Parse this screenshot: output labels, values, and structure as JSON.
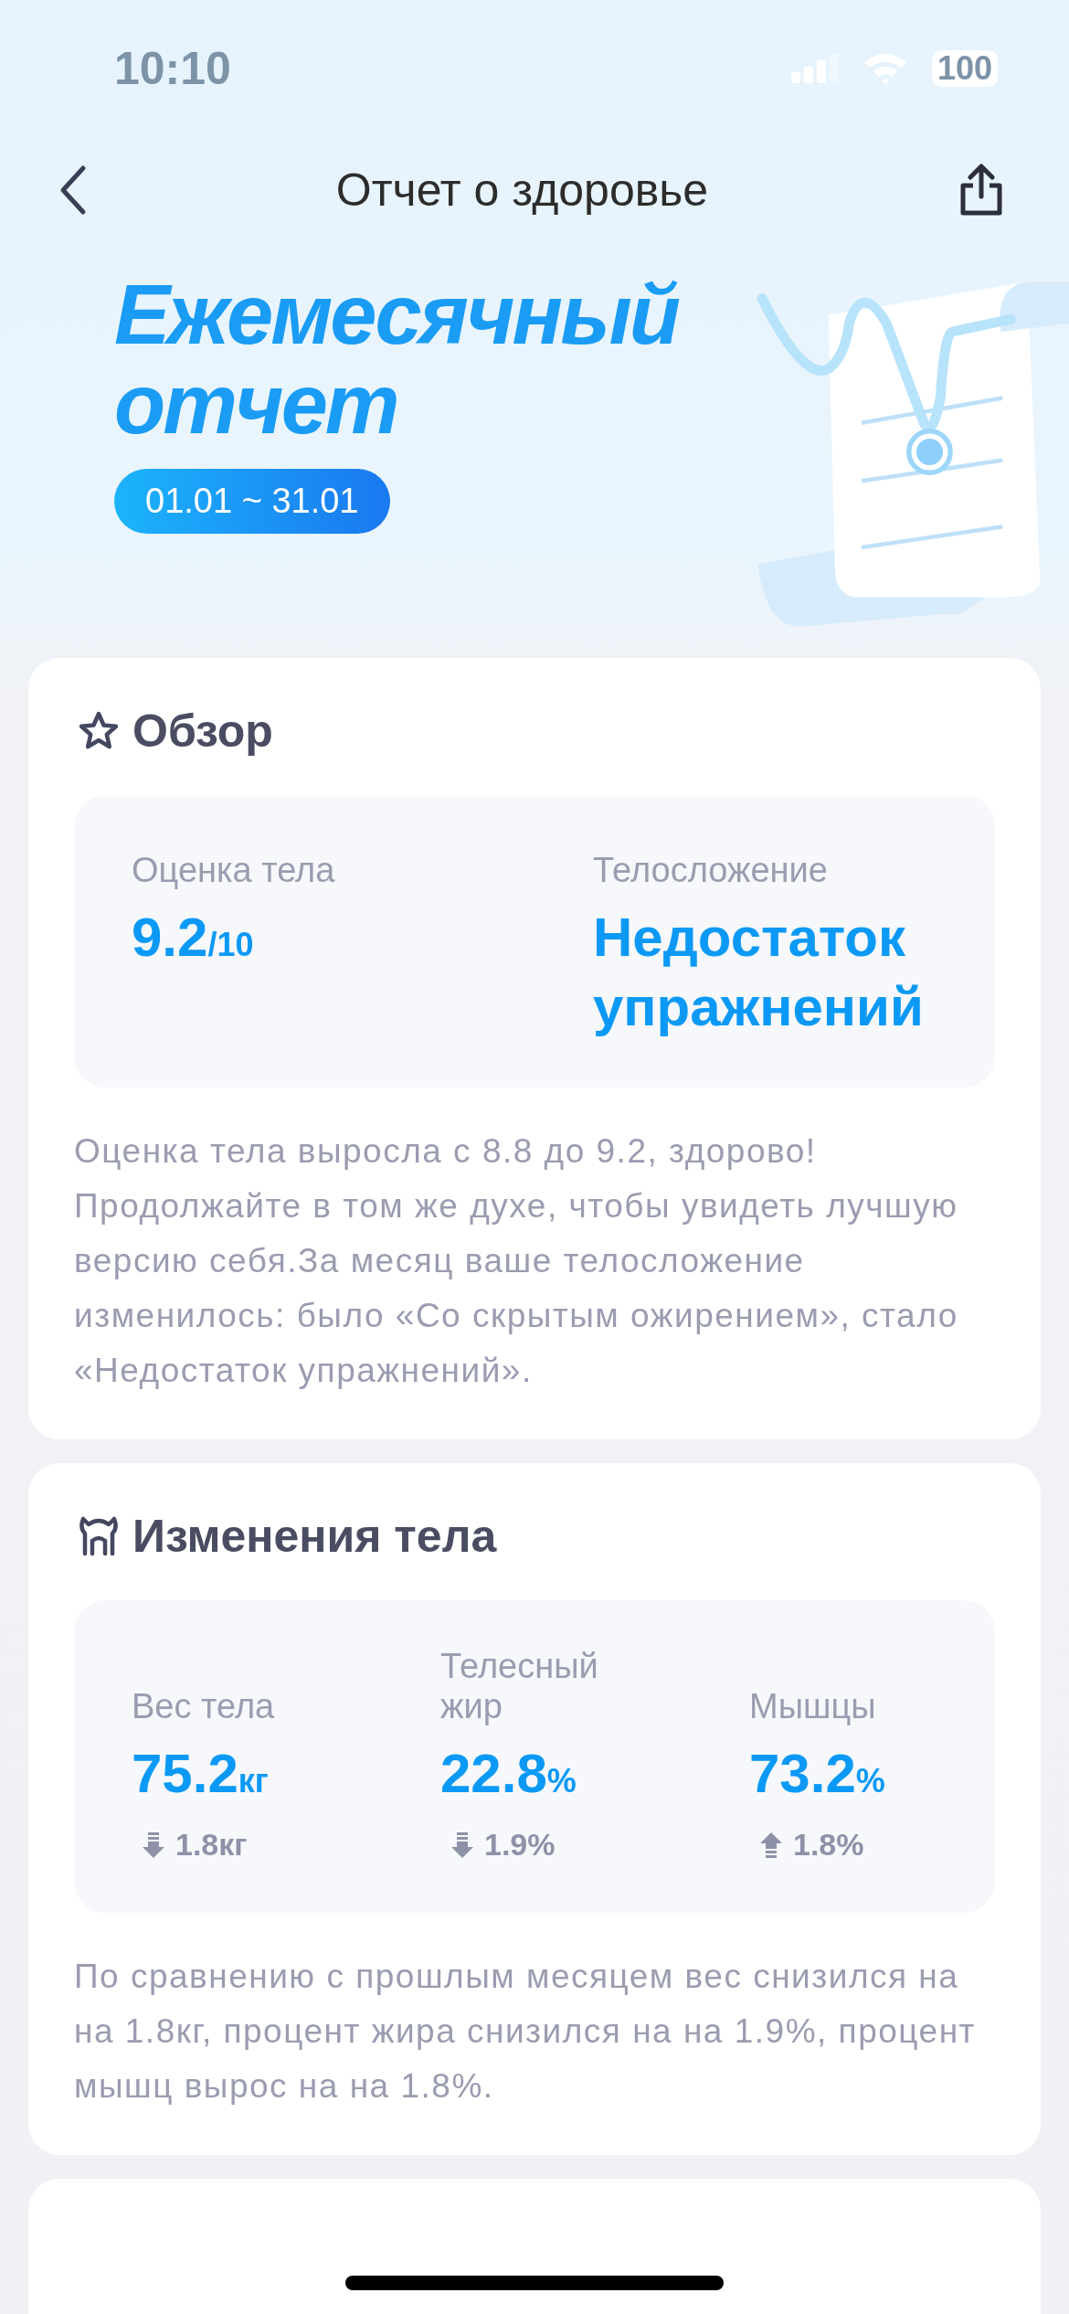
{
  "status_bar": {
    "time": "10:10",
    "battery": "100"
  },
  "nav": {
    "title": "Отчет о здоровье"
  },
  "hero": {
    "title": "Ежемесячный отчет",
    "period": "01.01 ~ 31.01"
  },
  "overview": {
    "title": "Обзор",
    "stats": [
      {
        "label": "Оценка тела",
        "value": "9.2",
        "unit": "/10"
      },
      {
        "label": "Телосложение",
        "value": "Недостаток упражнений"
      }
    ],
    "summary": "Оценка тела выросла с 8.8 до 9.2, здорово! Продолжайте в том же духе, чтобы увидеть лучшую версию себя.За месяц ваше телосложение изменилось: было «Со скрытым ожирением», стало «Недостаток упражнений»."
  },
  "body_changes": {
    "title": "Изменения тела",
    "stats": [
      {
        "label": "Вес тела",
        "value": "75.2",
        "unit": "кг",
        "kind": "down",
        "change": "1.8кг"
      },
      {
        "label": "Телесный жир",
        "value": "22.8",
        "unit": "%",
        "kind": "down",
        "change": "1.9%"
      },
      {
        "label": "Мышцы",
        "value": "73.2",
        "unit": "%",
        "kind": "up",
        "change": "1.8%"
      }
    ],
    "summary": "По сравнению с прошлым месяцем вес снизился на на 1.8кг, процент жира снизился на на 1.9%, процент мышц вырос на на 1.8%."
  }
}
